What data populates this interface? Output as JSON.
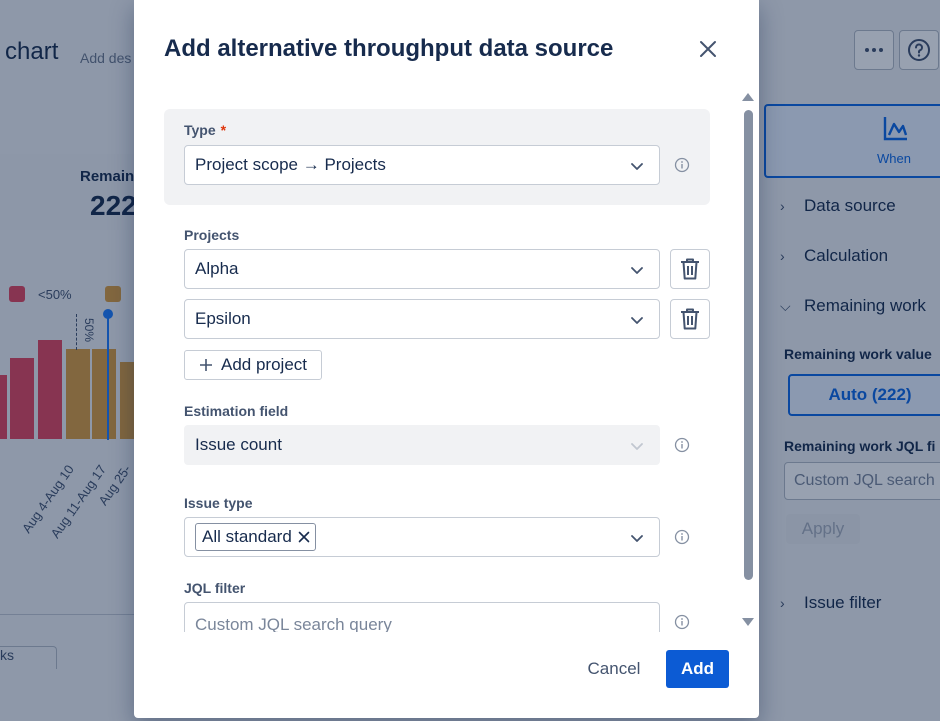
{
  "background": {
    "chart_title": "chart",
    "add_description": "Add des",
    "more_icon": "ellipsis-icon",
    "help_icon": "question-icon",
    "remaining_label": "Remain",
    "remaining_value": "222",
    "legend_label": "<50%",
    "marker_label": "50%",
    "x_labels": [
      "Aug 4-Aug 10",
      "Aug 11-Aug 17",
      "Aug 25-"
    ],
    "when_tab": "When",
    "accordion": {
      "data_source": "Data source",
      "calculation": "Calculation",
      "remaining_work": "Remaining work",
      "issue_filter": "Issue filter"
    },
    "remaining_work_value_label": "Remaining work value",
    "auto_button": "Auto (222)",
    "jql_label": "Remaining work JQL fi",
    "jql_placeholder": "Custom JQL search",
    "apply_button": "Apply",
    "bottom_select": "ks"
  },
  "modal": {
    "title": "Add alternative throughput data source",
    "type": {
      "label": "Type",
      "required_mark": "*",
      "value": "Project scope → Projects"
    },
    "projects": {
      "label": "Projects",
      "items": [
        {
          "value": "Alpha"
        },
        {
          "value": "Epsilon"
        }
      ],
      "add_label": "Add project"
    },
    "estimation": {
      "label": "Estimation field",
      "value": "Issue count"
    },
    "issue_type": {
      "label": "Issue type",
      "chip": "All standard"
    },
    "jql": {
      "label": "JQL filter",
      "placeholder": "Custom JQL search query"
    },
    "cancel_label": "Cancel",
    "add_label": "Add"
  },
  "colors": {
    "primary": "#0c5bd4",
    "bar_red": "#e2445c",
    "bar_orange": "#d99b3d",
    "marker_blue": "#1d7afc"
  }
}
